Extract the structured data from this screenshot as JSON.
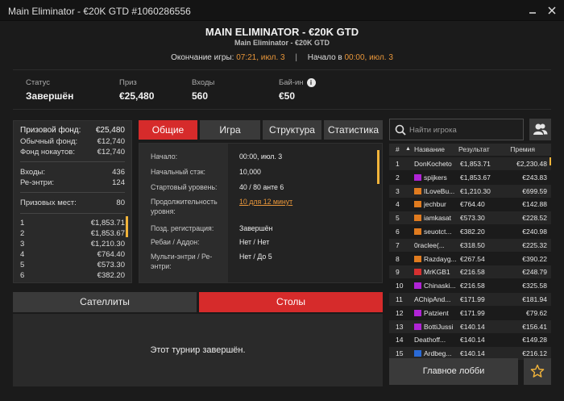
{
  "window": {
    "title": "Main Eliminator - €20K GTD #1060286556",
    "minimize_icon": "minimize-icon",
    "close_icon": "close-icon"
  },
  "header": {
    "title": "MAIN ELIMINATOR - €20K GTD",
    "subtitle": "Main Eliminator - €20K GTD",
    "end_label": "Окончание игры:",
    "end_value": "07:21, июл. 3",
    "separator": "|",
    "start_label": "Начало в",
    "start_value": "00:00, июл. 3"
  },
  "stats": {
    "status_label": "Статус",
    "status_value": "Завершён",
    "prize_label": "Приз",
    "prize_value": "€25,480",
    "entries_label": "Входы",
    "entries_value": "560",
    "buyin_label": "Бай-ин",
    "buyin_value": "€50",
    "info_icon": "i"
  },
  "prize_panel": {
    "rows": [
      {
        "label": "Призовой фонд:",
        "value": "€25,480"
      },
      {
        "label": "Обычный фонд:",
        "value": "€12,740"
      },
      {
        "label": "Фонд нокаутов:",
        "value": "€12,740"
      },
      {
        "label": "Входы:",
        "value": "436"
      },
      {
        "label": "Ре-энтри:",
        "value": "124"
      },
      {
        "label": "Призовых мест:",
        "value": "80"
      }
    ],
    "places": [
      {
        "place": "1",
        "amount": "€1,853.71"
      },
      {
        "place": "2",
        "amount": "€1,853.67"
      },
      {
        "place": "3",
        "amount": "€1,210.30"
      },
      {
        "place": "4",
        "amount": "€764.40"
      },
      {
        "place": "5",
        "amount": "€573.30"
      },
      {
        "place": "6",
        "amount": "€382.20"
      }
    ]
  },
  "tabs": [
    "Общие",
    "Игра",
    "Структура",
    "Статистика"
  ],
  "general": {
    "rows": [
      {
        "key": "Начало:",
        "value": "00:00, июл. 3"
      },
      {
        "key": "Начальный стэк:",
        "value": "10,000"
      },
      {
        "key": "Стартовый уровень:",
        "value": "40 / 80 анте 6"
      },
      {
        "key": "Продолжительность уровня:",
        "value": "10 для 12 минут"
      },
      {
        "key": "Позд. регистрация:",
        "value": "Завершён"
      },
      {
        "key": "Ребаи / Аддон:",
        "value": "Нет / Нет"
      },
      {
        "key": "Мульти-энтри / Ре-энтри:",
        "value": "Нет / До 5"
      }
    ]
  },
  "bottom_tabs": {
    "satellites": "Сателлиты",
    "tables": "Столы"
  },
  "finished_text": "Этот турнир завершён.",
  "search": {
    "placeholder": "Найти игрока"
  },
  "players": {
    "headers": {
      "rank": "#",
      "sort_arrow": "▲",
      "name": "Название",
      "result": "Результат",
      "prize": "Премия"
    },
    "rows": [
      {
        "rank": "1",
        "name": "DonKocheto",
        "result": "€1,853.71",
        "prize": "€2,230.48",
        "flag": ""
      },
      {
        "rank": "2",
        "name": "spijkers",
        "result": "€1,853.67",
        "prize": "€243.83",
        "flag": "#b024d6"
      },
      {
        "rank": "3",
        "name": "ILoveBu...",
        "result": "€1,210.30",
        "prize": "€699.59",
        "flag": "#e07b1f"
      },
      {
        "rank": "4",
        "name": "jechbur",
        "result": "€764.40",
        "prize": "€142.88",
        "flag": "#e07b1f"
      },
      {
        "rank": "5",
        "name": "iamkasat",
        "result": "€573.30",
        "prize": "€228.52",
        "flag": "#e07b1f"
      },
      {
        "rank": "6",
        "name": "seuotct...",
        "result": "€382.20",
        "prize": "€240.98",
        "flag": "#e07b1f"
      },
      {
        "rank": "7",
        "name": "0raclee(...",
        "result": "€318.50",
        "prize": "€225.32",
        "flag": ""
      },
      {
        "rank": "8",
        "name": "Razdayg...",
        "result": "€267.54",
        "prize": "€390.22",
        "flag": "#e07b1f"
      },
      {
        "rank": "9",
        "name": "MrKGB1",
        "result": "€216.58",
        "prize": "€248.79",
        "flag": "#d63030"
      },
      {
        "rank": "10",
        "name": "Chinaski...",
        "result": "€216.58",
        "prize": "€325.58",
        "flag": "#b024d6"
      },
      {
        "rank": "11",
        "name": "AChipAnd...",
        "result": "€171.99",
        "prize": "€181.94",
        "flag": ""
      },
      {
        "rank": "12",
        "name": "Patzient",
        "result": "€171.99",
        "prize": "€79.62",
        "flag": "#b024d6"
      },
      {
        "rank": "13",
        "name": "BottiJussi",
        "result": "€140.14",
        "prize": "€156.41",
        "flag": "#b024d6"
      },
      {
        "rank": "14",
        "name": "Deathoff...",
        "result": "€140.14",
        "prize": "€149.28",
        "flag": ""
      },
      {
        "rank": "15",
        "name": "Ardbeg...",
        "result": "€140.14",
        "prize": "€216.12",
        "flag": "#2a6ad6"
      }
    ]
  },
  "buttons": {
    "main_lobby": "Главное лобби"
  },
  "colors": {
    "accent_red": "#d62b2b",
    "accent_orange": "#e8963a",
    "scroll_yellow": "#f2b43a"
  }
}
